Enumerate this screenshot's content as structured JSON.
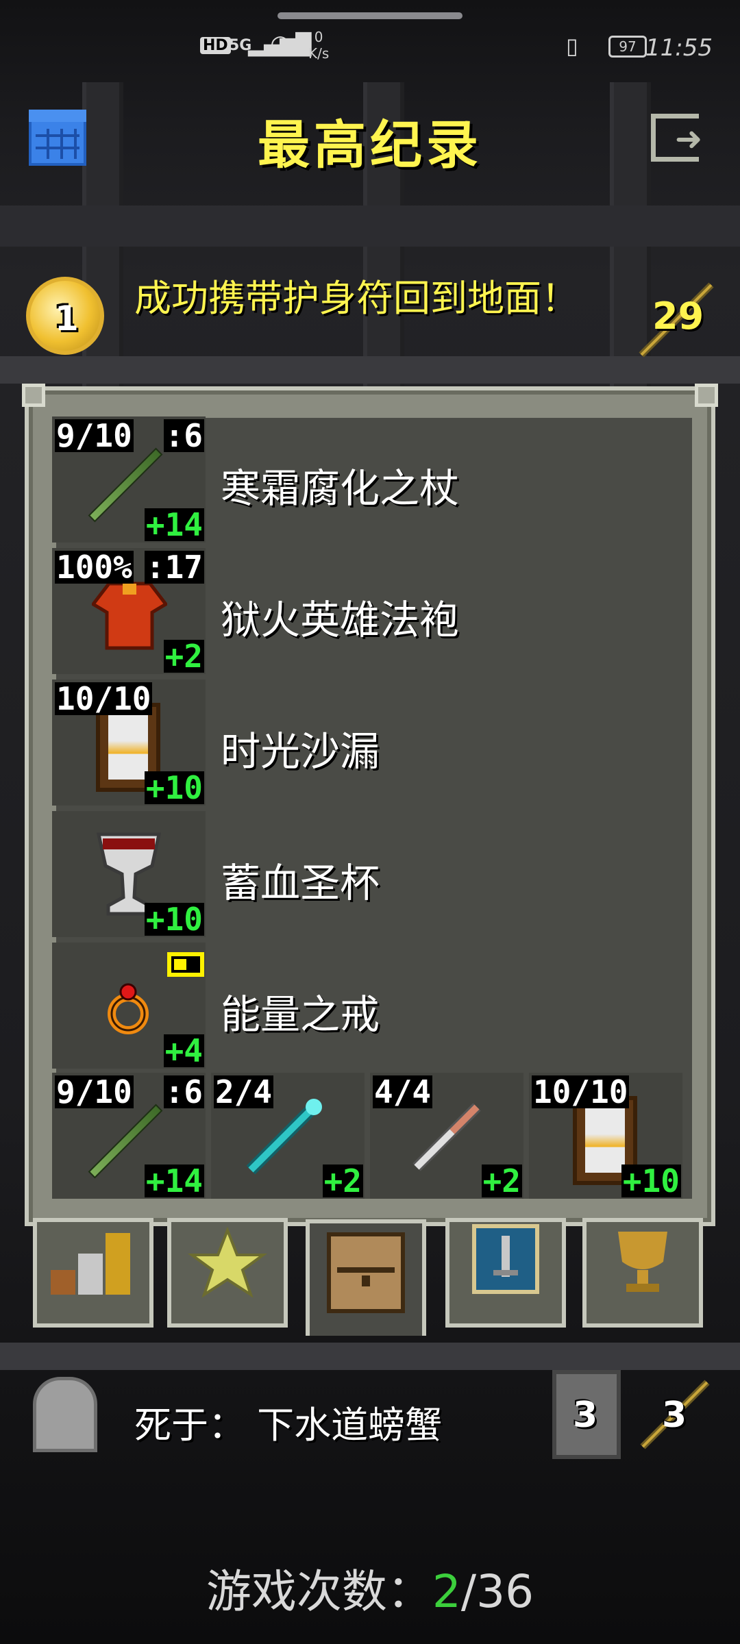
{
  "status_bar": {
    "hd": "HD",
    "signal": "5G",
    "net_speed": "0",
    "net_unit": "K/s",
    "battery": "97",
    "time": "11:55"
  },
  "header": {
    "title": "最高纪录",
    "left_icon": "calendar-icon",
    "right_icon": "exit-icon"
  },
  "summary": {
    "medal_rank": "1",
    "headline": "成功携带护身符回到地面！",
    "depth": "29"
  },
  "equipped": [
    {
      "name": "寒霜腐化之杖",
      "top_left": "9/10",
      "top_right": ":6",
      "level": "+14"
    },
    {
      "name": "狱火英雄法袍",
      "top_left": "100%",
      "top_right": ":17",
      "level": "+2"
    },
    {
      "name": "时光沙漏",
      "top_left": "10/10",
      "level": "+10"
    },
    {
      "name": "蓄血圣杯",
      "level": "+10"
    },
    {
      "name": "能量之戒",
      "level": "+4"
    }
  ],
  "quickslots": [
    {
      "top_left": "9/10",
      "top_right": ":6",
      "level": "+14"
    },
    {
      "top_left": "2/4",
      "level": "+2"
    },
    {
      "top_left": "4/4",
      "level": "+2"
    },
    {
      "top_left": "10/10",
      "level": "+10"
    }
  ],
  "tabs": [
    "stats-tab",
    "badges-tab",
    "items-tab",
    "challenges-tab",
    "trophy-tab"
  ],
  "footer": {
    "death": "死于：  下水道螃蟹",
    "depth_visited": "3",
    "staff_count": "3",
    "games_label": "游戏次数：",
    "games_current": "2",
    "games_total": "/36"
  },
  "colors": {
    "title": "#fff44f",
    "level_text": "#30f040",
    "panel_border": "#c6c8bc"
  }
}
